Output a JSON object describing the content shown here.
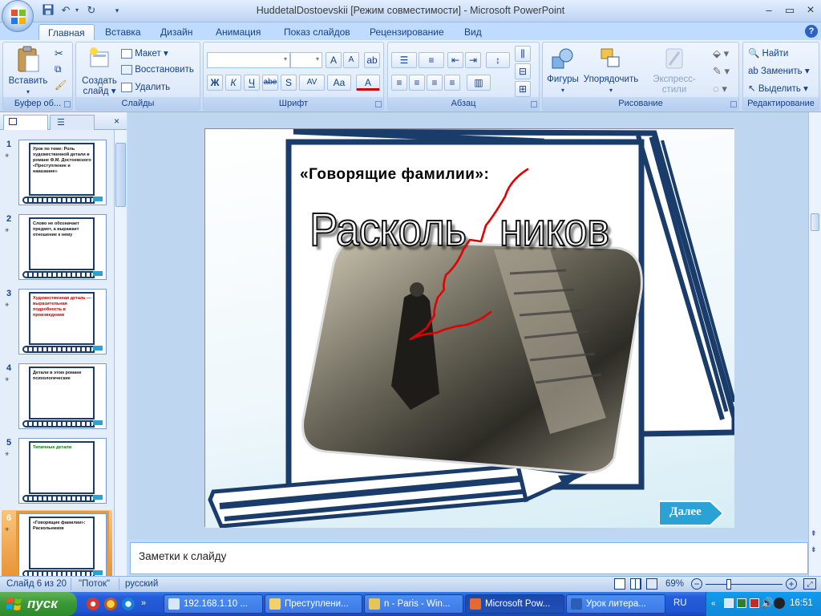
{
  "window": {
    "title": "HuddetalDostoevskii [Режим совместимости] - Microsoft PowerPoint",
    "minimize": "–",
    "restore": "▭",
    "close": "×"
  },
  "ribbon_tabs": [
    "Главная",
    "Вставка",
    "Дизайн",
    "Анимация",
    "Показ слайдов",
    "Рецензирование",
    "Вид"
  ],
  "ribbon": {
    "clipboard": {
      "paste": "Вставить",
      "label": "Буфер об..."
    },
    "slides": {
      "create": "Создать",
      "create2": "слайд",
      "layout": "Макет",
      "reset": "Восстановить",
      "delete": "Удалить",
      "label": "Слайды"
    },
    "font": {
      "label": "Шрифт",
      "bold": "Ж",
      "italic": "К",
      "underline": "Ч",
      "strike": "abe",
      "shadow": "S",
      "spacing": "AV",
      "case": "Aa",
      "color": "A",
      "grow": "A",
      "shrink": "A"
    },
    "paragraph": {
      "label": "Абзац"
    },
    "drawing": {
      "shapes": "Фигуры",
      "arrange": "Упорядочить",
      "quick_styles": "Экспресс-стили",
      "label": "Рисование"
    },
    "editing": {
      "find": "Найти",
      "replace": "Заменить",
      "select": "Выделить",
      "label": "Редактирование"
    }
  },
  "thumbnails": [
    {
      "num": "1",
      "text": "Урок по теме: Роль художественной детали в романе Ф.М. Достоевского «Преступление и наказание»"
    },
    {
      "num": "2",
      "text": "Слово не обозначает предмет, а выражает отношение к нему"
    },
    {
      "num": "3",
      "text": "Художественная деталь — выразительная подробность в произведении"
    },
    {
      "num": "4",
      "text": "Детали в этом романе психологические"
    },
    {
      "num": "5",
      "text": "Типичные детали"
    },
    {
      "num": "6",
      "text": "«Говорящие фамилии»: Раскольников"
    }
  ],
  "slide": {
    "heading": "«Говорящие фамилии»:",
    "word": "Расколь   ников",
    "next_button": "Далее"
  },
  "notes_placeholder": "Заметки к слайду",
  "status": {
    "slide": "Слайд 6 из 20",
    "theme": "\"Поток\"",
    "language": "русский",
    "zoom": "69%"
  },
  "taskbar": {
    "start": "пуск",
    "items": [
      "192.168.1.10 ...",
      "Преступлени...",
      "n - Paris - Win...",
      "Microsoft Pow...",
      "Урок литера..."
    ],
    "lang": "RU",
    "clock": "16:51"
  },
  "colors": {
    "accent": "#15428b",
    "slide_frame": "#1a3c6b",
    "next_button": "#2aa2d6",
    "red_line": "#e00000",
    "taskbar": "#245edb",
    "start": "#3a9a36"
  }
}
